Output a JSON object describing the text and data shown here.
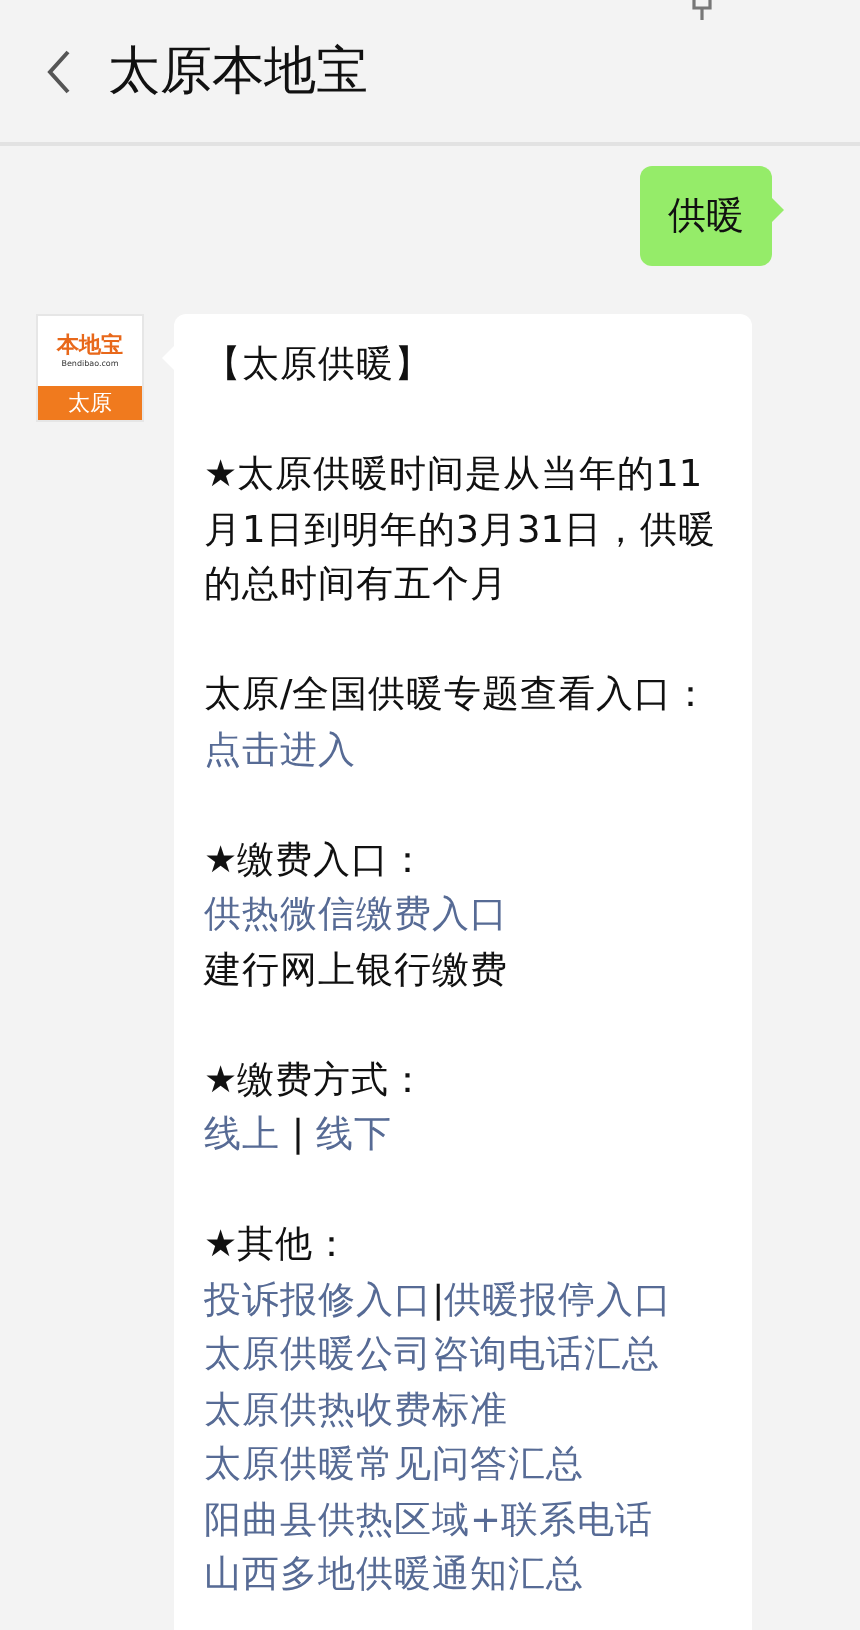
{
  "header": {
    "title": "太原本地宝"
  },
  "messages": [
    {
      "kind": "sent",
      "text": "供暖"
    },
    {
      "kind": "received",
      "avatar": {
        "brand": "本地宝",
        "site": "Bendibao.com",
        "city": "太原"
      },
      "paragraphs": [
        [
          [
            {
              "kind": "text",
              "text": "【太原供暖】"
            }
          ]
        ],
        [
          [
            {
              "kind": "text",
              "text": "★太原供暖时间是从当年的11月1日到明年的3月31日，供暖的总时间有五个月"
            }
          ]
        ],
        [
          [
            {
              "kind": "text",
              "text": "太原/全国供暖专题查看入口："
            },
            {
              "kind": "link",
              "text": "点击进入"
            }
          ]
        ],
        [
          [
            {
              "kind": "text",
              "text": "★缴费入口："
            }
          ],
          [
            {
              "kind": "link",
              "text": "供热微信缴费入口"
            }
          ],
          [
            {
              "kind": "text",
              "text": "建行网上银行缴费"
            }
          ]
        ],
        [
          [
            {
              "kind": "text",
              "text": "★缴费方式："
            }
          ],
          [
            {
              "kind": "link",
              "text": "线上"
            },
            {
              "kind": "text",
              "text": " | "
            },
            {
              "kind": "link",
              "text": "线下"
            }
          ]
        ],
        [
          [
            {
              "kind": "text",
              "text": "★其他："
            }
          ],
          [
            {
              "kind": "link",
              "text": "投诉报修入口"
            },
            {
              "kind": "text",
              "text": "|"
            },
            {
              "kind": "link",
              "text": "供暖报停入口"
            }
          ],
          [
            {
              "kind": "link",
              "text": "太原供暖公司咨询电话汇总"
            }
          ],
          [
            {
              "kind": "link",
              "text": "太原供热收费标准"
            }
          ],
          [
            {
              "kind": "link",
              "text": "太原供暖常见问答汇总"
            }
          ],
          [
            {
              "kind": "link",
              "text": "阳曲县供热区域+联系电话"
            }
          ],
          [
            {
              "kind": "link",
              "text": "山西多地供暖通知汇总"
            }
          ]
        ]
      ]
    }
  ]
}
